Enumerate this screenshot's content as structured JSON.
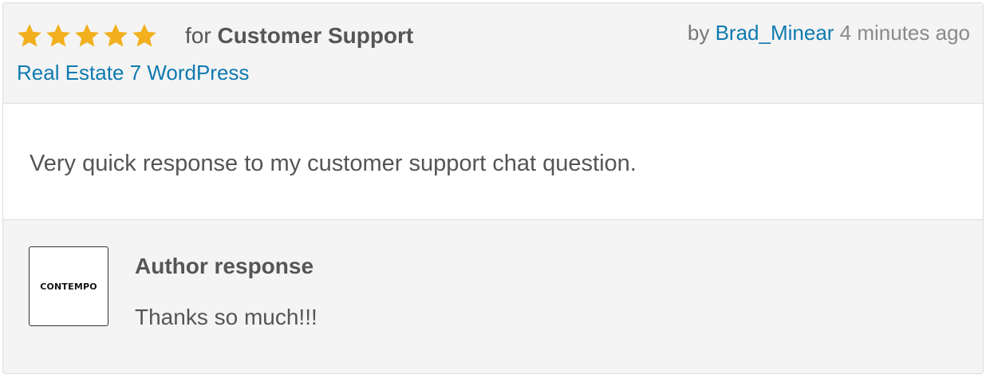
{
  "review": {
    "rating": 5,
    "rating_max": 5,
    "star_color": "#f2b01e",
    "for_prefix": "for",
    "category": "Customer Support",
    "theme_link": "Real Estate 7 WordPress",
    "by_prefix": "by",
    "author": "Brad_Minear",
    "time_ago": "4 minutes ago",
    "text": "Very quick response to my customer support chat question."
  },
  "author_response": {
    "logo_text": "CONTEMPO",
    "title": "Author response",
    "text": "Thanks so much!!!"
  },
  "colors": {
    "link": "#0f7ab0",
    "text": "#555555",
    "panel_bg": "#f4f4f4",
    "border": "#dcdcde"
  },
  "icons": {
    "star": "star-icon"
  }
}
